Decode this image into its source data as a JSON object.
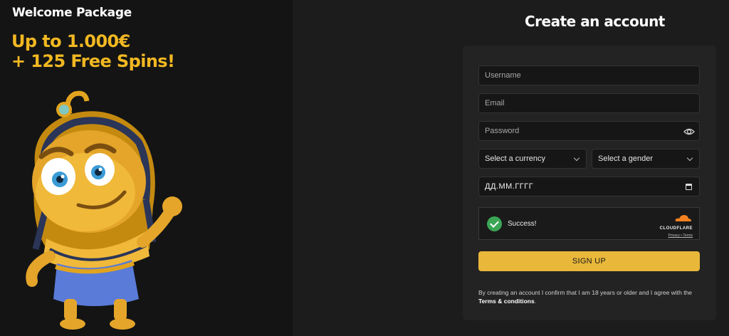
{
  "promo": {
    "welcome_title": "Welcome Package",
    "offer_line1": "Up to 1.000€",
    "offer_line2": "+ 125 Free Spins!",
    "accent_color": "#f2b822"
  },
  "form": {
    "title": "Create an account",
    "username_placeholder": "Username",
    "email_placeholder": "Email",
    "password_placeholder": "Password",
    "currency_select": "Select a currency",
    "gender_select": "Select a gender",
    "date_placeholder": "ДД.ММ.ГГГГ",
    "captcha_status": "Success!",
    "captcha_brand": "CLOUDFLARE",
    "captcha_privacy": "Privacy",
    "captcha_sep": " • ",
    "captcha_terms": "Terms",
    "signup_label": "SIGN UP",
    "signup_color": "#e9b83a",
    "terms_text": "By creating an account I confirm that I am 18 years or older and I agree with the ",
    "terms_link": "Terms & conditions",
    "terms_end": "."
  },
  "icons": [
    "eye-icon",
    "chevron-down-icon",
    "calendar-icon",
    "check-icon",
    "cloudflare-logo-icon"
  ]
}
